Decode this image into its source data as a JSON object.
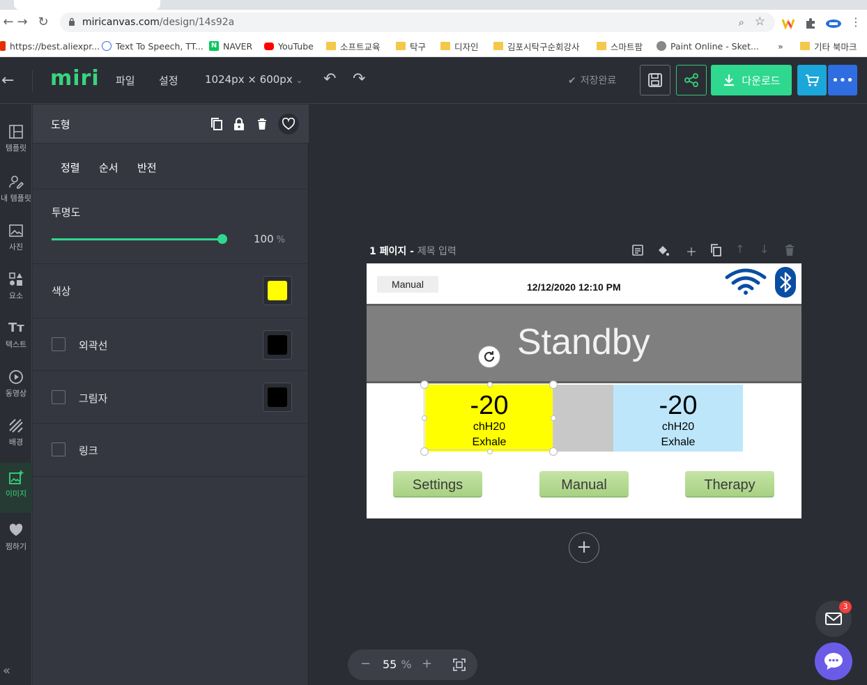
{
  "browser": {
    "url_host": "miricanvas.com",
    "url_path": "/design/14s92a",
    "bookmarks": [
      {
        "label": "https://best.aliexpr...",
        "color": "#e62e04"
      },
      {
        "label": "Text To Speech, TT...",
        "color": "#3a66d6"
      },
      {
        "label": "NAVER",
        "color": "#03c75a"
      },
      {
        "label": "YouTube",
        "color": "#ff0000"
      },
      {
        "label": "소프트교육",
        "color": "folder"
      },
      {
        "label": "탁구",
        "color": "folder"
      },
      {
        "label": "디자인",
        "color": "folder"
      },
      {
        "label": "김포시탁구순회강사",
        "color": "folder"
      },
      {
        "label": "스마트팜",
        "color": "folder"
      },
      {
        "label": "Paint Online - Sket...",
        "color": "#888888"
      }
    ],
    "more_bookmarks_chevron": "»",
    "other_bookmarks": "기타 북마크"
  },
  "header": {
    "logo": "miri",
    "menu": [
      "파일",
      "설정"
    ],
    "canvas_size": "1024px × 600px",
    "save_status": "저장완료",
    "download_label": "다운로드",
    "accent": "#2ed88e"
  },
  "rail": {
    "items": [
      {
        "label": "템플릿",
        "icon": "layout-icon"
      },
      {
        "label": "내 템플릿",
        "icon": "user-edit-icon"
      },
      {
        "label": "사진",
        "icon": "photo-icon"
      },
      {
        "label": "요소",
        "icon": "shapes-icon"
      },
      {
        "label": "텍스트",
        "icon": "text-icon"
      },
      {
        "label": "동영상",
        "icon": "play-icon"
      },
      {
        "label": "배경",
        "icon": "pattern-icon"
      },
      {
        "label": "이미지",
        "icon": "image-add-icon"
      },
      {
        "label": "찜하기",
        "icon": "heart-icon"
      }
    ],
    "active_index": 7
  },
  "panel": {
    "title": "도형",
    "tabs": [
      "정렬",
      "순서",
      "반전"
    ],
    "opacity": {
      "label": "투명도",
      "value": 100,
      "value_text": "100",
      "unit": "%"
    },
    "color": {
      "label": "색상",
      "value": "#ffff00"
    },
    "outline": {
      "label": "외곽선",
      "checked": false,
      "value": "#000000"
    },
    "shadow": {
      "label": "그림자",
      "checked": false,
      "value": "#000000"
    },
    "link": {
      "label": "링크",
      "checked": false
    }
  },
  "page": {
    "number_label": "1 페이지",
    "separator": " - ",
    "title_placeholder": "제목 입력"
  },
  "design": {
    "mode_tag": "Manual",
    "datetime": "12/12/2020 12:10 PM",
    "status": "Standby",
    "left_box": {
      "value": "-20",
      "unit": "chH20",
      "label": "Exhale",
      "color": "#ffff00"
    },
    "right_box": {
      "value": "-20",
      "unit": "chH20",
      "label": "Exhale",
      "color": "#bde6fb"
    },
    "buttons": [
      "Settings",
      "Manual",
      "Therapy"
    ]
  },
  "zoom": {
    "value": "55",
    "unit": "%"
  },
  "notifications": {
    "mail_count": "3"
  }
}
